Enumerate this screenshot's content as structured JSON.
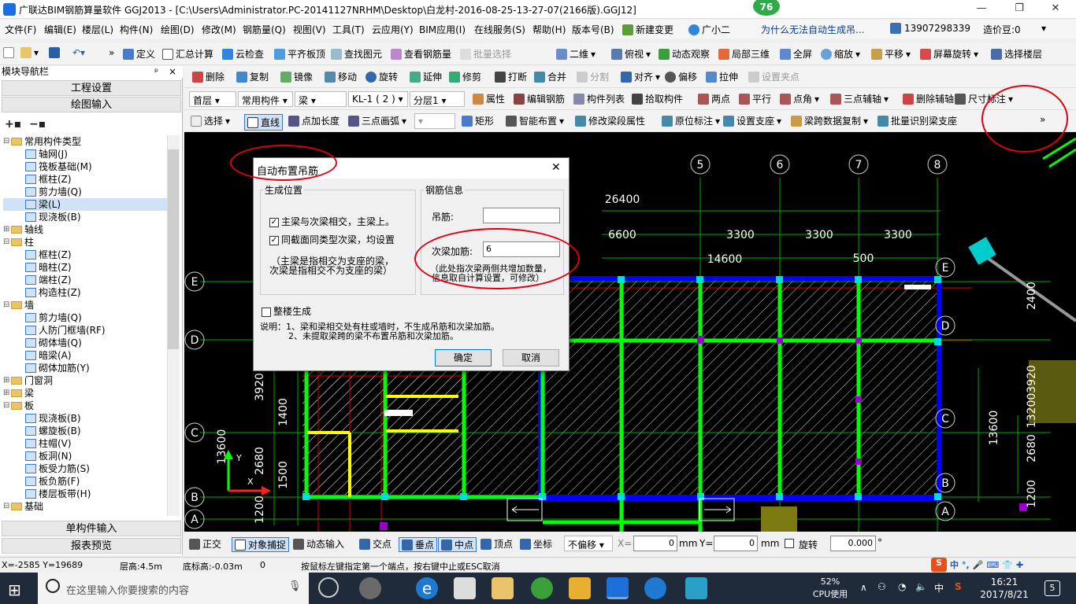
{
  "window": {
    "title": "广联达BIM钢筋算量软件 GGJ2013 - [C:\\Users\\Administrator.PC-20141127NRHM\\Desktop\\白龙村-2016-08-25-13-27-07(2166版).GGJ12]",
    "badge": "76",
    "min": "—",
    "max": "❐",
    "close": "✕"
  },
  "menu": {
    "items": [
      "文件(F)",
      "编辑(E)",
      "楼层(L)",
      "构件(N)",
      "绘图(D)",
      "修改(M)",
      "钢筋量(Q)",
      "视图(V)",
      "工具(T)",
      "云应用(Y)",
      "BIM应用(I)",
      "在线服务(S)",
      "帮助(H)",
      "版本号(B)",
      "新建变更",
      "广小二"
    ],
    "question": "为什么无法自动生成吊...",
    "phone": "13907298339",
    "points": "造价豆:0"
  },
  "toolbar1": [
    "定义",
    "汇总计算",
    "云检查",
    "平齐板顶",
    "查找图元",
    "查看钢筋量",
    "批量选择",
    "二维",
    "俯视",
    "动态观察",
    "局部三维",
    "全屏",
    "缩放",
    "平移",
    "屏幕旋转",
    "选择楼层"
  ],
  "toolbar2": [
    "删除",
    "复制",
    "镜像",
    "移动",
    "旋转",
    "延伸",
    "修剪",
    "打断",
    "合并",
    "分割",
    "对齐",
    "偏移",
    "拉伸",
    "设置夹点"
  ],
  "toolbar3": {
    "selects": [
      "首层",
      "常用构件",
      "梁",
      "KL-1 ( 2 )",
      "分层1"
    ],
    "items": [
      "属性",
      "编辑钢筋",
      "构件列表",
      "拾取构件",
      "两点",
      "平行",
      "点角",
      "三点辅轴",
      "删除辅轴",
      "尺寸标注"
    ]
  },
  "toolbar4": [
    "选择",
    "直线",
    "点加长度",
    "三点画弧",
    "矩形",
    "智能布置",
    "修改梁段属性",
    "原位标注",
    "设置支座",
    "梁跨数据复制",
    "批量识别梁支座"
  ],
  "sidebar": {
    "title": "模块导航栏",
    "pin": "ᵖ",
    "close": "×",
    "btn1": "工程设置",
    "btn2": "绘图输入",
    "btn3": "单构件输入",
    "btn4": "报表预览",
    "tree": [
      {
        "label": "常用构件类型",
        "level": 0,
        "folder": true,
        "tog": "⊟"
      },
      {
        "label": "轴网(J)",
        "level": 1
      },
      {
        "label": "筏板基础(M)",
        "level": 1
      },
      {
        "label": "框柱(Z)",
        "level": 1
      },
      {
        "label": "剪力墙(Q)",
        "level": 1
      },
      {
        "label": "梁(L)",
        "level": 1,
        "selected": true
      },
      {
        "label": "现浇板(B)",
        "level": 1
      },
      {
        "label": "轴线",
        "level": 0,
        "folder": true,
        "tog": "⊞"
      },
      {
        "label": "柱",
        "level": 0,
        "folder": true,
        "tog": "⊟"
      },
      {
        "label": "框柱(Z)",
        "level": 1
      },
      {
        "label": "暗柱(Z)",
        "level": 1
      },
      {
        "label": "端柱(Z)",
        "level": 1
      },
      {
        "label": "构造柱(Z)",
        "level": 1
      },
      {
        "label": "墙",
        "level": 0,
        "folder": true,
        "tog": "⊟"
      },
      {
        "label": "剪力墙(Q)",
        "level": 1
      },
      {
        "label": "人防门框墙(RF)",
        "level": 1
      },
      {
        "label": "砌体墙(Q)",
        "level": 1
      },
      {
        "label": "暗梁(A)",
        "level": 1
      },
      {
        "label": "砌体加筋(Y)",
        "level": 1
      },
      {
        "label": "门窗洞",
        "level": 0,
        "folder": true,
        "tog": "⊞"
      },
      {
        "label": "梁",
        "level": 0,
        "folder": true,
        "tog": "⊞"
      },
      {
        "label": "板",
        "level": 0,
        "folder": true,
        "tog": "⊟"
      },
      {
        "label": "现浇板(B)",
        "level": 1
      },
      {
        "label": "螺旋板(B)",
        "level": 1
      },
      {
        "label": "柱帽(V)",
        "level": 1
      },
      {
        "label": "板洞(N)",
        "level": 1
      },
      {
        "label": "板受力筋(S)",
        "level": 1
      },
      {
        "label": "板负筋(F)",
        "level": 1
      },
      {
        "label": "楼层板带(H)",
        "level": 1
      },
      {
        "label": "基础",
        "level": 0,
        "folder": true,
        "tog": "⊟"
      }
    ]
  },
  "dialog": {
    "title": "自动布置吊筋",
    "close": "✕",
    "pos_group": "生成位置",
    "opt1": "主梁与次梁相交，主梁上。",
    "opt2": "同截面同类型次梁，均设置",
    "note1": "（主梁是指相交为支座的梁，",
    "note2": "次梁是指相交不为支座的梁）",
    "rebar_group": "钢筋信息",
    "label_hanger": "吊筋:",
    "label_add": "次梁加筋:",
    "value_hanger": "",
    "value_add": "6",
    "rebar_note1": "（此处指次梁两侧共增加数量，",
    "rebar_note2": "信息取自计算设置，可修改）",
    "whole": "整楼生成",
    "explain1": "说明：1、梁和梁相交处有柱或墙时，不生成吊筋和次梁加筋。",
    "explain2": "2、未提取梁跨的梁不布置吊筋和次梁加筋。",
    "ok": "确定",
    "cancel": "取消",
    "check": "✓"
  },
  "canvas": {
    "axis_top": [
      "5",
      "6",
      "7",
      "8"
    ],
    "axis_left": [
      "E",
      "D",
      "C",
      "B",
      "A"
    ],
    "axis_right": [
      "E",
      "D",
      "C",
      "B",
      "A"
    ],
    "dims_top": [
      "26400",
      "6600",
      "3300",
      "3300",
      "3300",
      "14600",
      "500"
    ],
    "dims_left": [
      "3920",
      "1400",
      "13600",
      "2680",
      "1500",
      "1200"
    ],
    "dims_right": [
      "2400",
      "13600",
      "2680",
      "1200",
      "3920",
      "13200"
    ],
    "ucs_x": "X",
    "ucs_y": "Y"
  },
  "snapbar": {
    "items": [
      "正交",
      "对象捕捉",
      "动态输入",
      "交点",
      "垂点",
      "中点",
      "顶点",
      "坐标"
    ],
    "offset": "不偏移",
    "x_label": "X=",
    "x_val": "0",
    "y_label": "Y=",
    "y_val": "0",
    "mm": "mm",
    "rotate": "旋转",
    "rot_val": "0.000",
    "deg": "°"
  },
  "status": {
    "coords": "X=-2585 Y=19689",
    "floor_h": "层高:4.5m",
    "base_h": "底标高:-0.03m",
    "num": "0",
    "hint": "按鼠标左键指定第一个端点，按右键中止或ESC取消"
  },
  "taskbar": {
    "search": "在这里输入你要搜索的内容",
    "cpu_pct": "52%",
    "cpu_label": "CPU使用",
    "time": "16:21",
    "date": "2017/8/21",
    "lang": "中",
    "notif": "5",
    "ime": "S中·"
  },
  "colors": {
    "accent": "#0078d7",
    "red": "#e00010",
    "green": "#00ff00",
    "blue": "#0000ff"
  }
}
